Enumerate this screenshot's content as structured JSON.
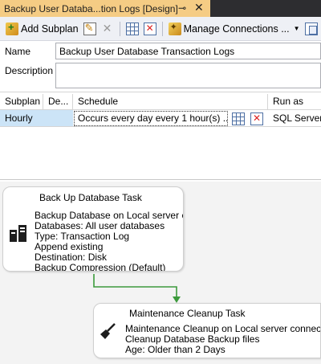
{
  "tab": {
    "title": "Backup User Databa...tion Logs [Design]",
    "pin": "⊸",
    "close": "✕"
  },
  "toolbar": {
    "add_subplan": "Add Subplan",
    "manage_connections": "Manage Connections ..."
  },
  "form": {
    "name_label": "Name",
    "name_value": "Backup User Database Transaction Logs",
    "description_label": "Description",
    "description_value": ""
  },
  "grid": {
    "columns": [
      "Subplan",
      "De...",
      "Schedule",
      "Run as"
    ],
    "rows": [
      {
        "subplan": "Hourly",
        "description": "",
        "schedule": "Occurs every day every 1 hour(s) ...",
        "run_as": "SQL Server A"
      }
    ]
  },
  "designer": {
    "tasks": [
      {
        "title": "Back Up Database Task",
        "lines": [
          "Backup Database on Local server c",
          "Databases: All user databases",
          "Type: Transaction Log",
          "Append existing",
          "Destination: Disk",
          "Backup Compression (Default)"
        ]
      },
      {
        "title": "Maintenance Cleanup Task",
        "lines": [
          "Maintenance Cleanup on Local server connection",
          "Cleanup Database Backup files",
          "Age: Older than 2 Days"
        ]
      }
    ],
    "connector_color": "#3c9a3c"
  },
  "colors": {
    "tab_active": "#f5cc84",
    "selection": "#cce4f7",
    "toolbar_bg": "#eef0f5"
  }
}
